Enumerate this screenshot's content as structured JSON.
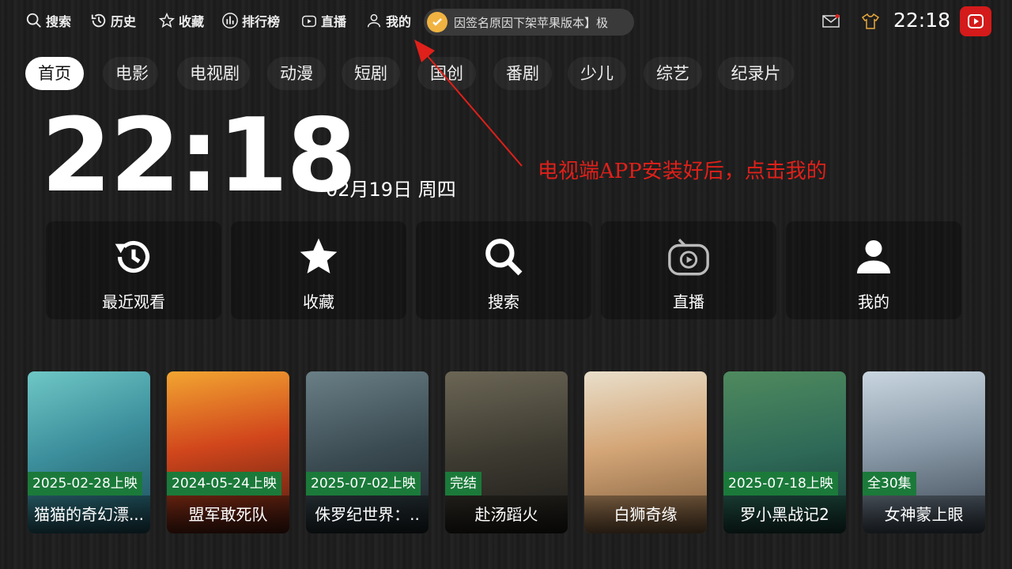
{
  "topnav": [
    {
      "label": "搜索",
      "icon": "search-icon"
    },
    {
      "label": "历史",
      "icon": "history-icon"
    },
    {
      "label": "收藏",
      "icon": "star-icon"
    },
    {
      "label": "排行榜",
      "icon": "chart-icon"
    },
    {
      "label": "直播",
      "icon": "tv-icon"
    },
    {
      "label": "我的",
      "icon": "user-icon"
    }
  ],
  "ticker": {
    "text": "因签名原因下架苹果版本】极",
    "icon": "coin-icon"
  },
  "status": {
    "time": "22:18",
    "icons": [
      "mail-icon",
      "shirt-icon"
    ]
  },
  "tabs": [
    "首页",
    "电影",
    "电视剧",
    "动漫",
    "短剧",
    "国创",
    "番剧",
    "少儿",
    "综艺",
    "纪录片"
  ],
  "active_tab": "首页",
  "clock": {
    "time": "22:18",
    "date": "02月19日 周四"
  },
  "annotation": "电视端APP安装好后，点击我的",
  "quick_actions": [
    {
      "label": "最近观看",
      "icon": "history-icon"
    },
    {
      "label": "收藏",
      "icon": "star-icon"
    },
    {
      "label": "搜索",
      "icon": "search-icon"
    },
    {
      "label": "直播",
      "icon": "tv-play-icon"
    },
    {
      "label": "我的",
      "icon": "user-icon"
    }
  ],
  "movies": [
    {
      "badge": "2025-02-28上映",
      "title": "猫猫的奇幻漂..."
    },
    {
      "badge": "2024-05-24上映",
      "title": "盟军敢死队"
    },
    {
      "badge": "2025-07-02上映",
      "title": "侏罗纪世界：.."
    },
    {
      "badge": "完结",
      "title": "赴汤蹈火"
    },
    {
      "badge": "",
      "title": "白狮奇缘"
    },
    {
      "badge": "2025-07-18上映",
      "title": "罗小黑战记2"
    },
    {
      "badge": "全30集",
      "title": "女神蒙上眼"
    }
  ],
  "colors": {
    "accent": "#e0201a",
    "badge": "#1b7a3a",
    "logo": "#d41a1a"
  }
}
